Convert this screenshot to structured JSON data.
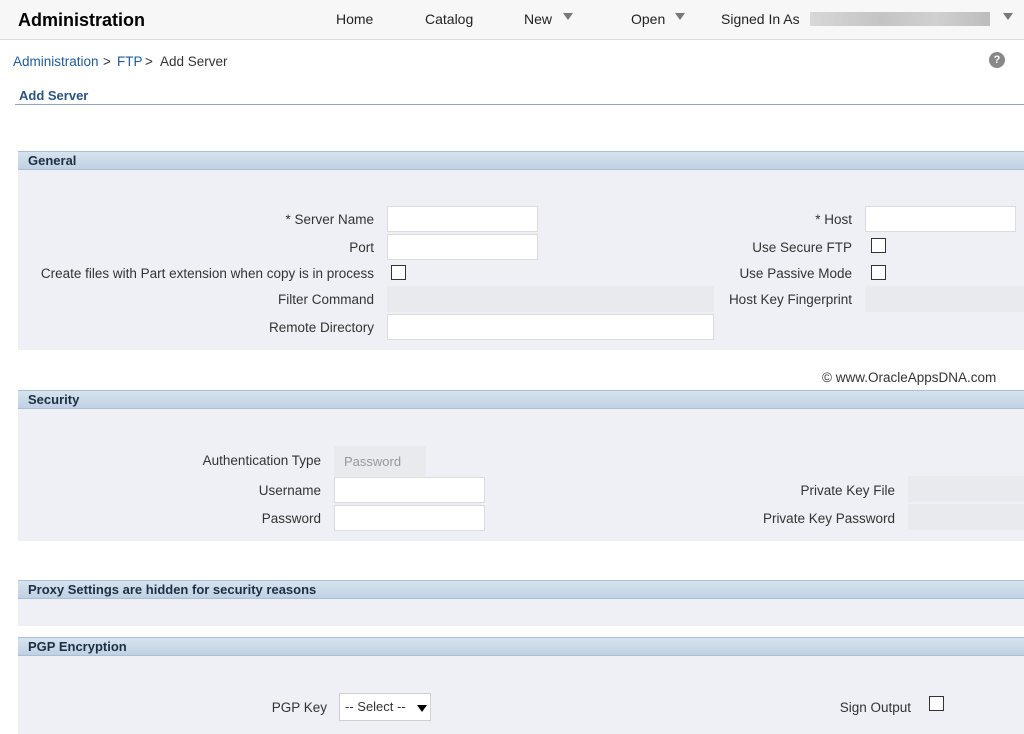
{
  "topbar": {
    "app_title": "Administration",
    "nav": {
      "home": "Home",
      "catalog": "Catalog",
      "new": "New",
      "open": "Open",
      "signed_in": "Signed In As"
    }
  },
  "breadcrumb": {
    "items": [
      "Administration",
      "FTP",
      "Add Server"
    ],
    "separator": ">"
  },
  "help_icon_glyph": "?",
  "page_title": "Add Server",
  "general": {
    "header": "General",
    "server_name_label": "* Server Name",
    "host_label": "* Host",
    "port_label": "Port",
    "use_secure_ftp_label": "Use Secure FTP",
    "part_extension_label": "Create files with Part extension when copy is in process",
    "use_passive_mode_label": "Use Passive Mode",
    "filter_command_label": "Filter Command",
    "host_key_fingerprint_label": "Host Key Fingerprint",
    "remote_directory_label": "Remote Directory"
  },
  "watermark": "© www.OracleAppsDNA.com",
  "security": {
    "header": "Security",
    "auth_type_label": "Authentication Type",
    "auth_type_value": "Password",
    "username_label": "Username",
    "password_label": "Password",
    "private_key_file_label": "Private Key File",
    "private_key_password_label": "Private Key Password"
  },
  "proxy": {
    "header": "Proxy Settings are hidden for security reasons"
  },
  "pgp": {
    "header": "PGP Encryption",
    "pgp_key_label": "PGP Key",
    "pgp_key_value": "-- Select --",
    "sign_output_label": "Sign Output"
  }
}
